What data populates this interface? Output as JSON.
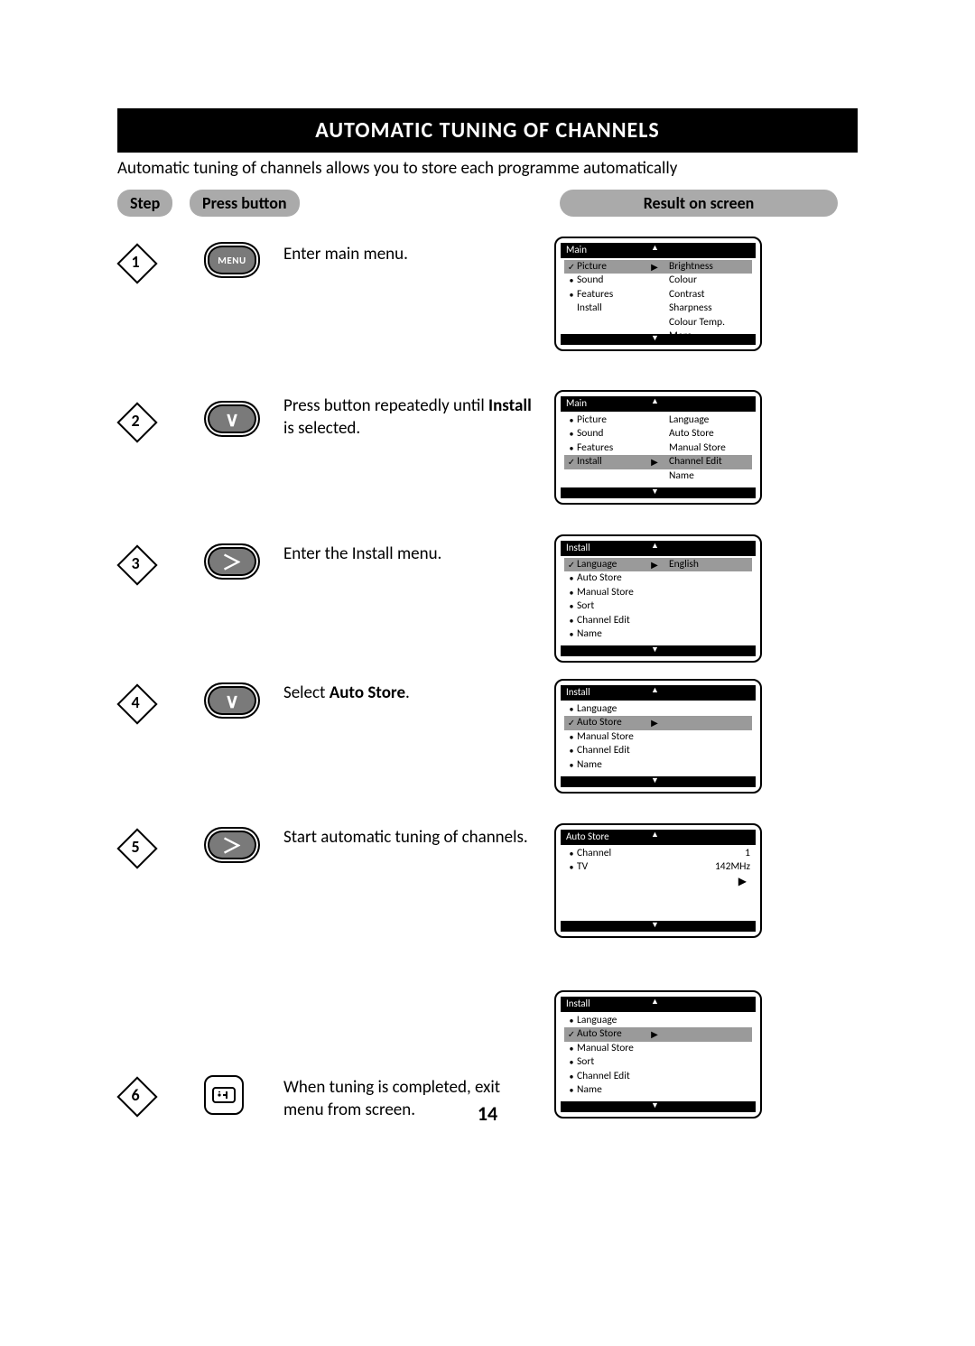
{
  "title": "Automatic Tuning Of Channels",
  "intro": "Automatic tuning of channels allows you to store each programme automatically",
  "columns": {
    "step": "Step",
    "press": "Press button",
    "result": "Result on screen"
  },
  "page_number": "14",
  "buttons": {
    "menu": "MENU",
    "down_glyph": "∨",
    "right_glyph": "＞"
  },
  "steps": [
    {
      "n": "1",
      "button": "menu",
      "instr_plain": "Enter main menu.",
      "osd": {
        "title": "Main",
        "left": [
          {
            "mark": "✓",
            "label": "Picture",
            "selected": true,
            "cursor": true
          },
          {
            "mark": "•",
            "label": "Sound"
          },
          {
            "mark": "•",
            "label": "Features"
          },
          {
            "mark": "",
            "label": "Install"
          }
        ],
        "right": [
          "Brightness",
          "Colour",
          "Contrast",
          "Sharpness",
          "Colour Temp.",
          "More..."
        ]
      }
    },
    {
      "n": "2",
      "button": "down",
      "instr_pre": "Press button repeatedly until ",
      "instr_bold": "Install",
      "instr_post": " is selected.",
      "osd": {
        "title": "Main",
        "left": [
          {
            "mark": "•",
            "label": "Picture"
          },
          {
            "mark": "•",
            "label": "Sound"
          },
          {
            "mark": "•",
            "label": "Features"
          },
          {
            "mark": "✓",
            "label": "Install",
            "selected": true,
            "cursor": true
          }
        ],
        "right": [
          "Language",
          "Auto Store",
          "Manual Store",
          "Channel Edit",
          "Name"
        ]
      }
    },
    {
      "n": "3",
      "button": "right",
      "instr_plain": "Enter the Install menu.",
      "osd": {
        "title": "Install",
        "left": [
          {
            "mark": "✓",
            "label": "Language",
            "selected": true,
            "cursor": true
          },
          {
            "mark": "•",
            "label": "Auto Store"
          },
          {
            "mark": "•",
            "label": "Manual Store"
          },
          {
            "mark": "•",
            "label": "Sort"
          },
          {
            "mark": "•",
            "label": "Channel Edit"
          },
          {
            "mark": "•",
            "label": "Name"
          }
        ],
        "right": [
          "English"
        ]
      }
    },
    {
      "n": "4",
      "button": "down",
      "instr_pre": "Select ",
      "instr_bold": "Auto Store",
      "instr_post": ".",
      "osd": {
        "title": "Install",
        "left": [
          {
            "mark": "•",
            "label": "Language"
          },
          {
            "mark": "✓",
            "label": "Auto Store",
            "selected": true,
            "cursor": true
          },
          {
            "mark": "•",
            "label": "Manual Store"
          },
          {
            "mark": "•",
            "label": "Channel Edit"
          },
          {
            "mark": "•",
            "label": "Name"
          }
        ],
        "right": []
      }
    },
    {
      "n": "5",
      "button": "right",
      "instr_plain": "Start automatic tuning of channels.",
      "osd": {
        "title": "Auto Store",
        "left": [
          {
            "mark": "•",
            "label": "Channel",
            "value": "1"
          },
          {
            "mark": "•",
            "label": "TV",
            "value": "142MHz"
          }
        ],
        "right": [],
        "progress": true
      }
    },
    {
      "n": "6",
      "button": "info",
      "instr_plain": "When tuning is completed, exit menu from screen.",
      "osd": {
        "title": "Install",
        "left": [
          {
            "mark": "•",
            "label": "Language"
          },
          {
            "mark": "✓",
            "label": "Auto Store",
            "selected": true,
            "cursor": true
          },
          {
            "mark": "•",
            "label": "Manual Store"
          },
          {
            "mark": "•",
            "label": "Sort"
          },
          {
            "mark": "•",
            "label": "Channel Edit"
          },
          {
            "mark": "•",
            "label": "Name"
          }
        ],
        "right": []
      }
    }
  ]
}
